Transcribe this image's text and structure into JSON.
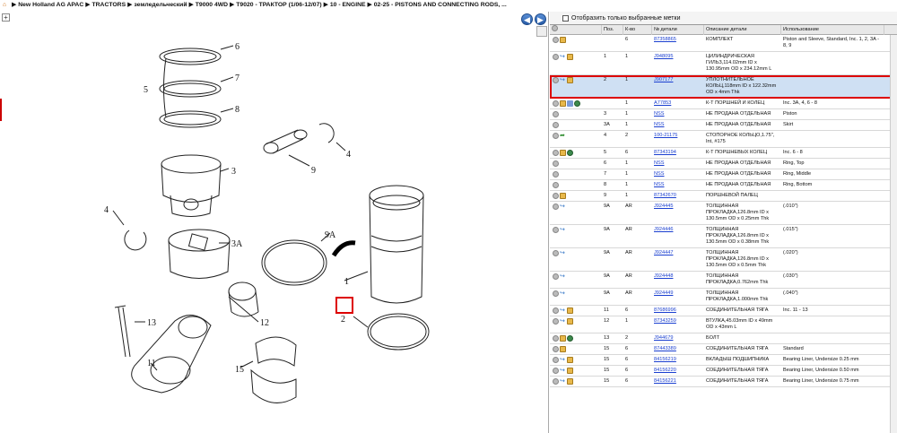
{
  "breadcrumb": [
    "New Holland AG APAC",
    "TRACTORS",
    "земледельческий",
    "T9000 4WD",
    "T9020 - ТРАКТОР (1/06-12/07)",
    "10 - ENGINE",
    "02-25 - PISTONS AND CONNECTING RODS, ..."
  ],
  "diagram": {
    "callouts": [
      "6",
      "7",
      "8",
      "5",
      "4",
      "9",
      "3",
      "4",
      "3A",
      "9A",
      "1",
      "2",
      "13",
      "12",
      "11",
      "15"
    ],
    "highlighted": "2"
  },
  "filter": {
    "label": "Отобразить только выбранные метки",
    "checked": false
  },
  "table": {
    "headers": [
      "",
      "Поз.",
      "К-во",
      "№ детали",
      "Описание детали",
      "Использование"
    ],
    "rows": [
      {
        "icons": [
          "gear",
          "box"
        ],
        "pos": "",
        "qty": "6",
        "num": "87358865",
        "desc": "КОМПЛЕКТ",
        "use": "Piston and Sleeve, Standard, Inc. 1, 2, 3A - 8, 9"
      },
      {
        "icons": [
          "gear",
          "arrow",
          "box"
        ],
        "pos": "1",
        "qty": "1",
        "num": "J948095",
        "desc": "ЦИЛИНДРИЧЕСКАЯ ГИЛЬЗ,114.02mm ID x 130.95mm OD x 234.12mm L",
        "use": ""
      },
      {
        "icons": [
          "gear",
          "arrow",
          "box"
        ],
        "pos": "2",
        "qty": "1",
        "num": "J907177",
        "desc": "УПЛОТНИТЕЛЬНОЕ КОЛЬЦ,118mm ID x 122.32mm OD x 4mm Thk",
        "use": "",
        "selected": true
      },
      {
        "icons": [
          "gear",
          "box",
          "wrench",
          "globe"
        ],
        "pos": "",
        "qty": "1",
        "num": "A77853",
        "desc": "К-Т ПОРШНЕЙ И КОЛЕЦ",
        "use": "Inc. 3A, 4, 6 - 8"
      },
      {
        "icons": [
          "gear"
        ],
        "pos": "3",
        "qty": "1",
        "num": "NSS",
        "desc": "НЕ ПРОДАНА ОТДЕЛЬНАЯ",
        "use": "Piston"
      },
      {
        "icons": [
          "gear"
        ],
        "pos": "3A",
        "qty": "1",
        "num": "NSS",
        "desc": "НЕ ПРОДАНА ОТДЕЛЬНАЯ",
        "use": "Skirt"
      },
      {
        "icons": [
          "gear",
          "green"
        ],
        "pos": "4",
        "qty": "2",
        "num": "100-21175",
        "desc": "СТОПОРНОЕ КОЛЬЦО,1.75\", Int, #175",
        "use": ""
      },
      {
        "icons": [
          "gear",
          "box",
          "globe"
        ],
        "pos": "5",
        "qty": "6",
        "num": "87343194",
        "desc": "К-Т ПОРШНЕВЫХ КОЛЕЦ",
        "use": "Inc. 6 - 8"
      },
      {
        "icons": [
          "gear"
        ],
        "pos": "6",
        "qty": "1",
        "num": "NSS",
        "desc": "НЕ ПРОДАНА ОТДЕЛЬНАЯ",
        "use": "Ring, Top"
      },
      {
        "icons": [
          "gear"
        ],
        "pos": "7",
        "qty": "1",
        "num": "NSS",
        "desc": "НЕ ПРОДАНА ОТДЕЛЬНАЯ",
        "use": "Ring, Middle"
      },
      {
        "icons": [
          "gear"
        ],
        "pos": "8",
        "qty": "1",
        "num": "NSS",
        "desc": "НЕ ПРОДАНА ОТДЕЛЬНАЯ",
        "use": "Ring, Bottom"
      },
      {
        "icons": [
          "gear",
          "box"
        ],
        "pos": "9",
        "qty": "1",
        "num": "87342670",
        "desc": "ПОРШНЕВОЙ ПАЛЕЦ",
        "use": ""
      },
      {
        "icons": [
          "gear",
          "arrow"
        ],
        "pos": "9A",
        "qty": "AR",
        "num": "J924445",
        "desc": "ТОЛЩИННАЯ ПРОКЛАДКА,126.8mm ID x 130.5mm OD x 0.25mm Thk",
        "use": "(.010\")"
      },
      {
        "icons": [
          "gear",
          "arrow"
        ],
        "pos": "9A",
        "qty": "AR",
        "num": "J924446",
        "desc": "ТОЛЩИННАЯ ПРОКЛАДКА,126.8mm ID x 130.5mm OD x 0.38mm Thk",
        "use": "(.015\")"
      },
      {
        "icons": [
          "gear",
          "arrow"
        ],
        "pos": "9A",
        "qty": "AR",
        "num": "J924447",
        "desc": "ТОЛЩИННАЯ ПРОКЛАДКА,126.8mm ID x 130.5mm OD x 0.5mm Thk",
        "use": "(.020\")"
      },
      {
        "icons": [
          "gear",
          "arrow"
        ],
        "pos": "9A",
        "qty": "AR",
        "num": "J924448",
        "desc": "ТОЛЩИННАЯ ПРОКЛАДКА,0.762mm Thk",
        "use": "(.030\")"
      },
      {
        "icons": [
          "gear",
          "arrow"
        ],
        "pos": "9A",
        "qty": "AR",
        "num": "J924449",
        "desc": "ТОЛЩИННАЯ ПРОКЛАДКА,1.000mm Thk",
        "use": "(.040\")"
      },
      {
        "icons": [
          "gear",
          "arrow",
          "box"
        ],
        "pos": "11",
        "qty": "6",
        "num": "87686996",
        "desc": "СОЕДИНИТЕЛЬНАЯ ТЯГА",
        "use": "Inc. 11 - 13"
      },
      {
        "icons": [
          "gear",
          "arrow",
          "box"
        ],
        "pos": "12",
        "qty": "1",
        "num": "87343259",
        "desc": "ВТУЛКА,45.03mm ID x 49mm OD x 43mm L",
        "use": ""
      },
      {
        "icons": [
          "gear",
          "box",
          "globe"
        ],
        "pos": "13",
        "qty": "2",
        "num": "J944679",
        "desc": "БОЛТ",
        "use": ""
      },
      {
        "icons": [
          "gear",
          "box"
        ],
        "pos": "15",
        "qty": "6",
        "num": "87443389",
        "desc": "СОЕДИНИТЕЛЬНАЯ ТЯГА",
        "use": "Standard"
      },
      {
        "icons": [
          "gear",
          "arrow",
          "box"
        ],
        "pos": "15",
        "qty": "6",
        "num": "84156219",
        "desc": "ВКЛАДЫШ ПОДШИПНИКА",
        "use": "Bearing Liner, Undersize 0.25 mm"
      },
      {
        "icons": [
          "gear",
          "arrow",
          "box"
        ],
        "pos": "15",
        "qty": "6",
        "num": "84156220",
        "desc": "СОЕДИНИТЕЛЬНАЯ ТЯГА",
        "use": "Bearing Liner, Undersize 0.50 mm"
      },
      {
        "icons": [
          "gear",
          "arrow",
          "box"
        ],
        "pos": "15",
        "qty": "6",
        "num": "84156221",
        "desc": "СОЕДИНИТЕЛЬНАЯ ТЯГА",
        "use": "Bearing Liner, Undersize 0.75 mm"
      }
    ]
  }
}
